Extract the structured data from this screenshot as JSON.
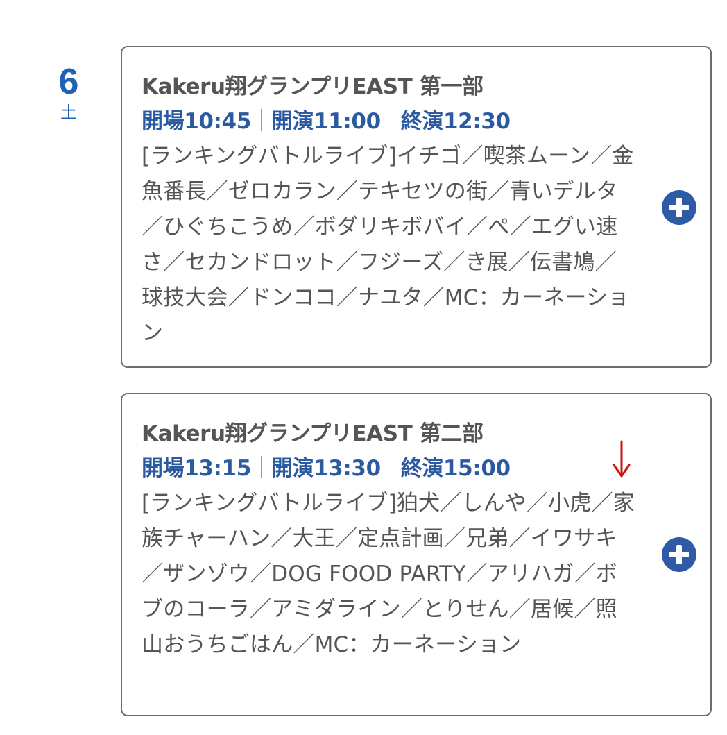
{
  "date": {
    "day": "6",
    "weekday": "土"
  },
  "events": [
    {
      "title": "Kakeru翔グランプリEAST 第一部",
      "times": {
        "open": "開場10:45",
        "start": "開演11:00",
        "end": "終演12:30"
      },
      "description": "[ランキングバトルライブ]イチゴ／喫茶ムーン／金魚番長／ゼロカラン／テキセツの街／青いデルタ／ひぐちこうめ／ボダリキボバイ／ぺ／エグい速さ／セカンドロット／フジーズ／き展／伝書鳩／球技大会／ドンココ／ナユタ／MC：カーネーション"
    },
    {
      "title": "Kakeru翔グランプリEAST 第二部",
      "times": {
        "open": "開場13:15",
        "start": "開演13:30",
        "end": "終演15:00"
      },
      "description": "[ランキングバトルライブ]狛犬／しんや／小虎／家族チャーハン／大王／定点計画／兄弟／イワサキ／ザンゾウ／DOG FOOD PARTY／アリハガ／ボブのコーラ／アミダライン／とりせん／居候／照山おうちごはん／MC：カーネーション"
    }
  ],
  "icons": {
    "expand": "plus-circle-icon",
    "annotation": "red-down-arrow-icon"
  },
  "colors": {
    "date": "#1e63b5",
    "times": "#2c5aa0",
    "text": "#555555",
    "button": "#2f5aa6",
    "border": "#6e6e6e",
    "annotation": "#cc1111"
  }
}
